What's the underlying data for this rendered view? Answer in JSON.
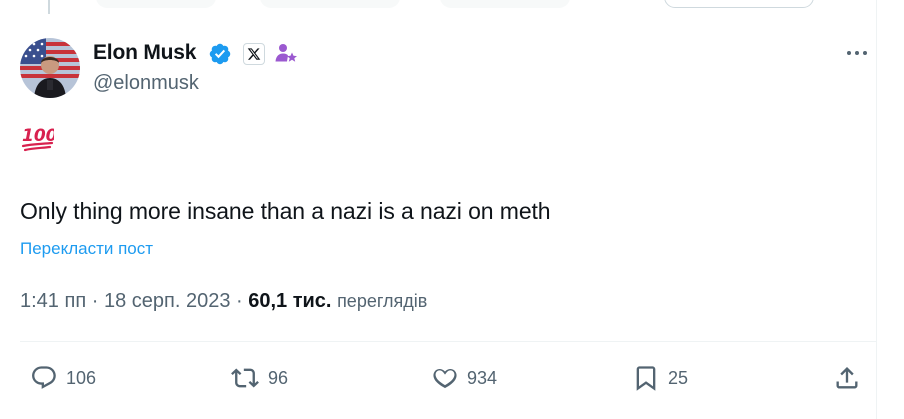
{
  "tweet": {
    "author": {
      "name": "Elon Musk",
      "handle": "@elonmusk",
      "avatar_icon": "avatar-photo",
      "badges": [
        "verified-icon",
        "x-logo-icon",
        "affiliate-icon"
      ]
    },
    "emoji": "💯",
    "text": "Only thing more insane than a nazi is a nazi on meth",
    "translate_label": "Перекласти пост",
    "meta": {
      "time": "1:41 пп",
      "separator": "·",
      "date": "18 серп. 2023",
      "views_count": "60,1 тис.",
      "views_label": "переглядів"
    },
    "actions": {
      "replies": "106",
      "reposts": "96",
      "likes": "934",
      "bookmarks": "25"
    }
  },
  "colors": {
    "text": "#0f1419",
    "secondary": "#536471",
    "link": "#1d9bf0",
    "verified": "#1d9bf0",
    "affiliate": "#9b59d0",
    "divider": "#eff3f4"
  }
}
